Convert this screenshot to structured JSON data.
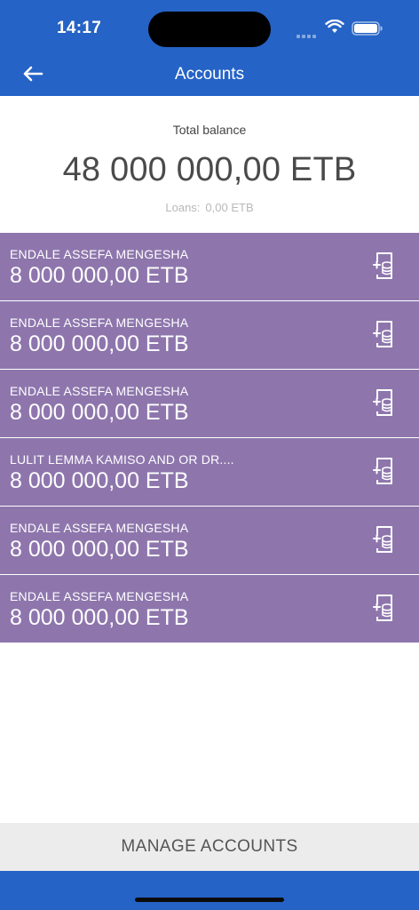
{
  "status": {
    "time": "14:17"
  },
  "nav": {
    "title": "Accounts"
  },
  "balance": {
    "label": "Total balance",
    "amount": "48 000 000,00 ETB",
    "loans_label": "Loans:",
    "loans_value": "0,00 ETB"
  },
  "accounts": [
    {
      "name": "ENDALE ASSEFA MENGESHA",
      "amount": "8 000 000,00 ETB"
    },
    {
      "name": "ENDALE ASSEFA MENGESHA",
      "amount": "8 000 000,00 ETB"
    },
    {
      "name": "ENDALE ASSEFA MENGESHA",
      "amount": "8 000 000,00 ETB"
    },
    {
      "name": "LULIT LEMMA KAMISO AND OR DR....",
      "amount": "8 000 000,00 ETB"
    },
    {
      "name": "ENDALE ASSEFA MENGESHA",
      "amount": "8 000 000,00 ETB"
    },
    {
      "name": "ENDALE ASSEFA MENGESHA",
      "amount": "8 000 000,00 ETB"
    }
  ],
  "account_icon": "add-money-document-icon",
  "manage": {
    "label": "MANAGE ACCOUNTS"
  },
  "colors": {
    "brand_blue": "#2563c6",
    "account_purple": "#8e76ad",
    "manage_bg": "#ececec"
  }
}
